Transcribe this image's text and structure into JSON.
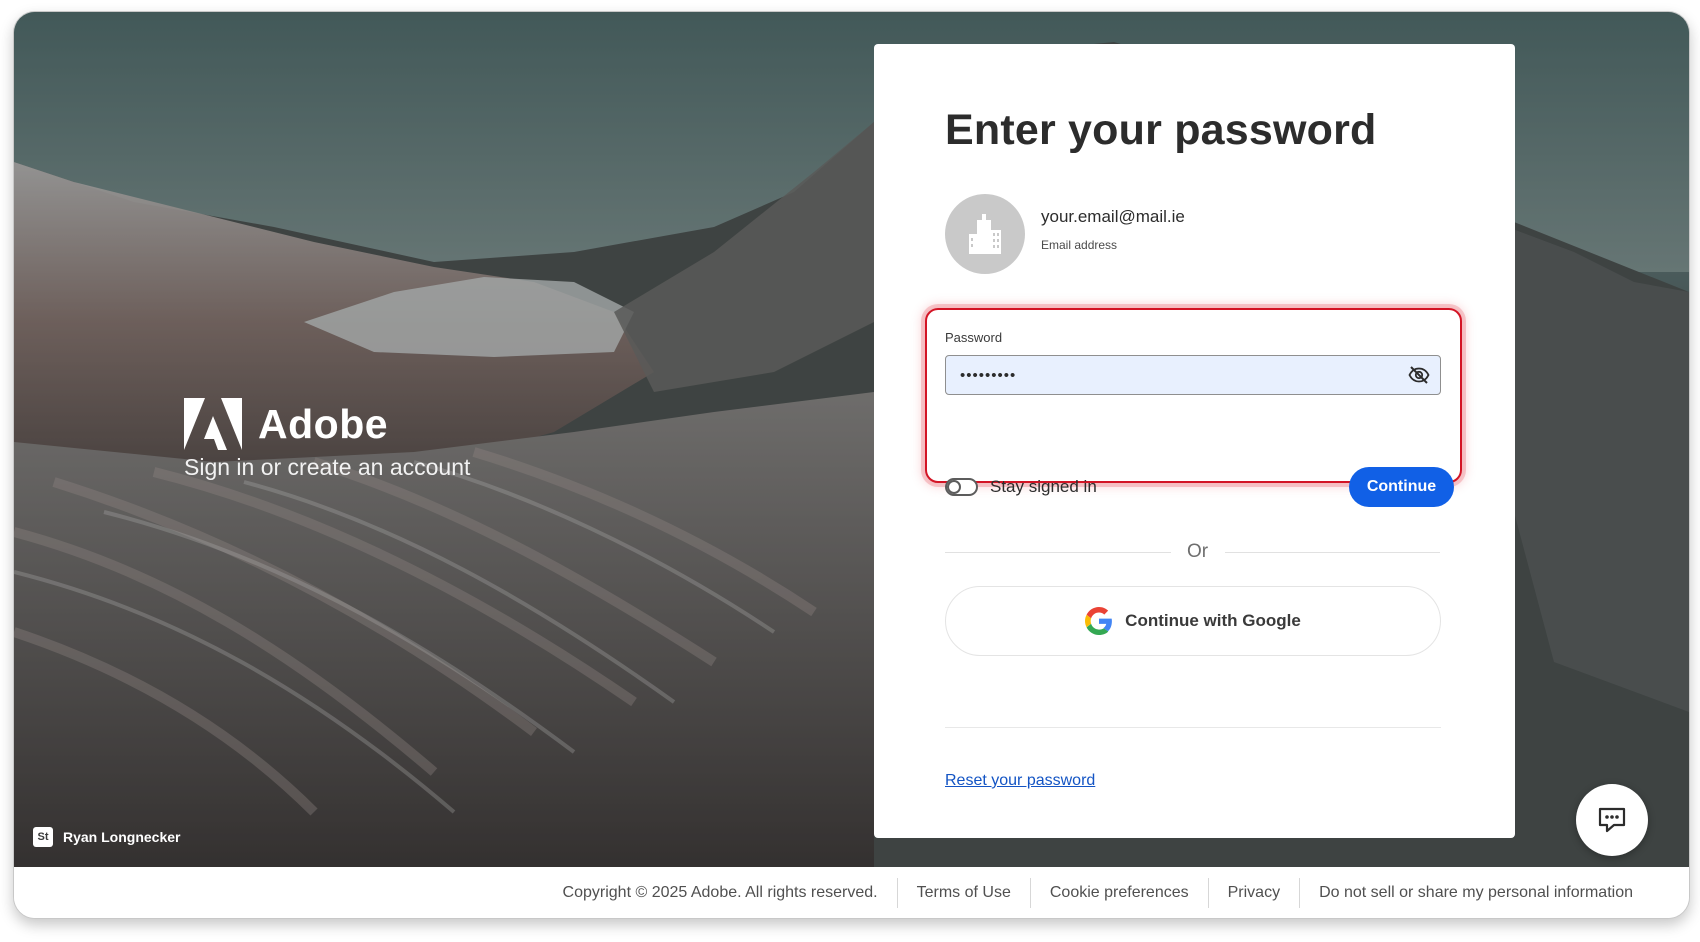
{
  "brand": {
    "name": "Adobe",
    "tagline": "Sign in or create an account"
  },
  "photo_credit": {
    "badge": "St",
    "name": "Ryan Longnecker"
  },
  "card": {
    "title": "Enter your password",
    "email": "your.email@mail.ie",
    "email_label": "Email address",
    "password_label": "Password",
    "password_value": "•••••••••",
    "stay_signed_in_label": "Stay signed in",
    "stay_signed_in_checked": false,
    "continue_label": "Continue",
    "or_label": "Or",
    "google_label": "Continue with Google",
    "reset_link": "Reset your password"
  },
  "footer": {
    "copyright": "Copyright © 2025 Adobe. All rights reserved.",
    "links": [
      "Terms of Use",
      "Cookie preferences",
      "Privacy",
      "Do not sell or share my personal information"
    ]
  },
  "colors": {
    "accent": "#1160e6",
    "highlight": "#d31425",
    "link": "#1354c4"
  },
  "icons": {
    "avatar": "building-icon",
    "password_toggle": "eye-slash-icon",
    "google": "google-g-icon",
    "chat": "chat-bubble-icon"
  }
}
